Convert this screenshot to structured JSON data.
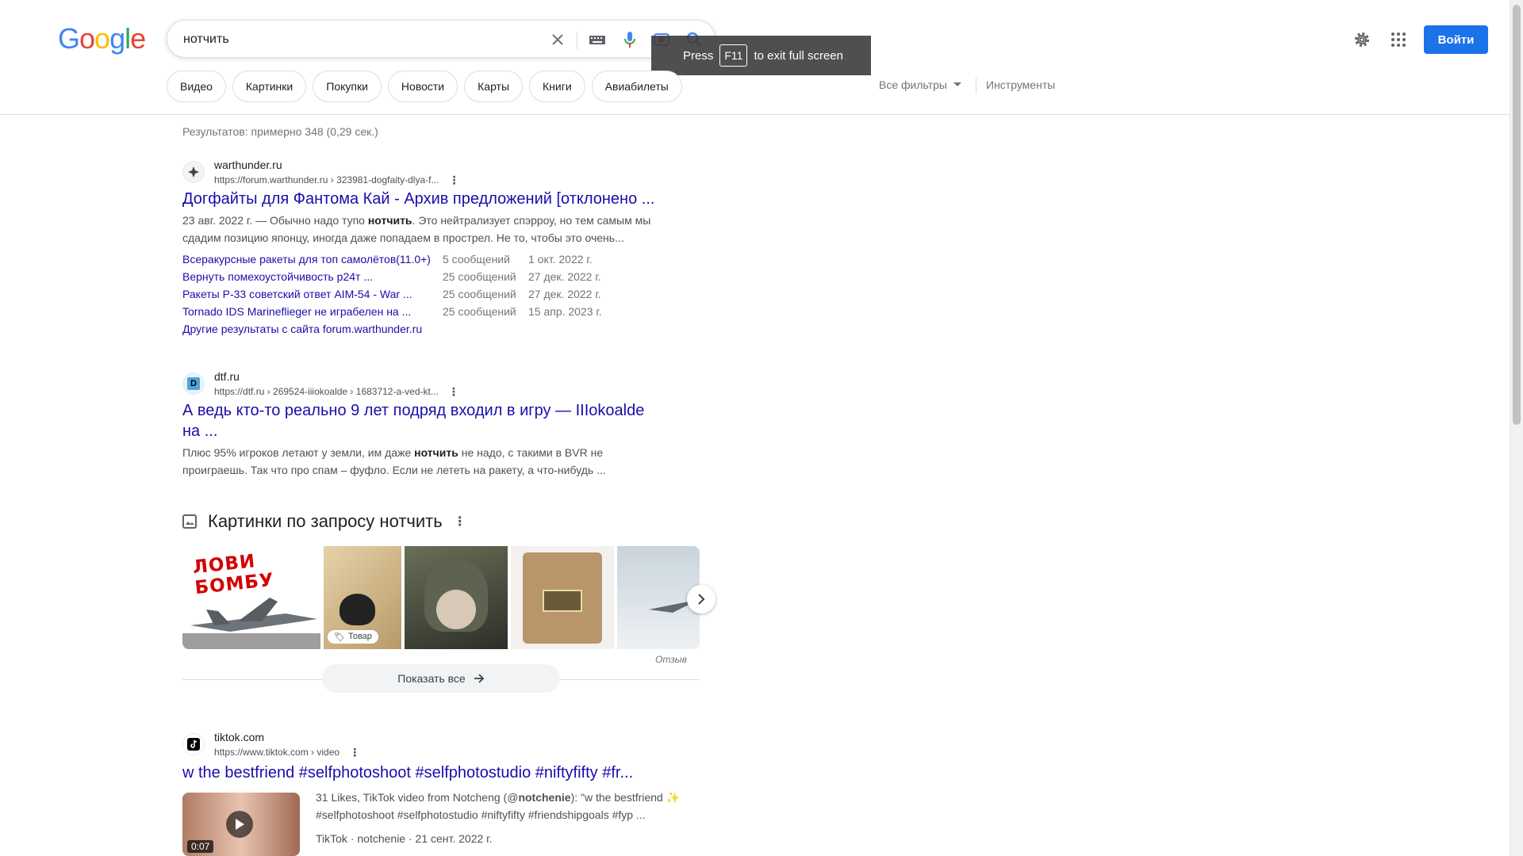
{
  "header": {
    "logo_letters": [
      "G",
      "o",
      "o",
      "g",
      "l",
      "e"
    ],
    "search_value": "нотчить",
    "fullscreen_toast": {
      "press": "Press",
      "key": "F11",
      "rest": "to exit full screen"
    },
    "signin_label": "Войти",
    "chips": [
      "Видео",
      "Картинки",
      "Покупки",
      "Новости",
      "Карты",
      "Книги",
      "Авиабилеты"
    ],
    "all_filters": "Все фильтры",
    "tools": "Инструменты"
  },
  "stats": "Результатов: примерно 348 (0,29 сек.)",
  "results": [
    {
      "site": "warthunder.ru",
      "url": "https://forum.warthunder.ru › 323981-dogfaity-dlya-f...",
      "title": "Догфайты для Фантома Кай - Архив предложений [отклонено ...",
      "snippet_pre": "23 авг. 2022 г. — Обычно надо тупо ",
      "snippet_bold": "нотчить",
      "snippet_post": ". Это нейтрализует спэрроу, но тем самым мы сдадим позицию японцу, иногда даже попадаем в прострел. Не то, чтобы это очень...",
      "sitelinks": [
        {
          "title": "Всеракурсные ракеты для топ самолётов(11.0+)",
          "count": "5 сообщений",
          "date": "1 окт. 2022 г."
        },
        {
          "title": "Вернуть помехоустойчивость р24т ...",
          "count": "25 сообщений",
          "date": "27 дек. 2022 г."
        },
        {
          "title": "Ракеты Р-33 советский ответ AIM-54 - War ...",
          "count": "25 сообщений",
          "date": "27 дек. 2022 г."
        },
        {
          "title": "Tornado IDS Marineflieger не играбелен на ...",
          "count": "25 сообщений",
          "date": "15 апр. 2023 г."
        }
      ],
      "more": "Другие результаты с сайта forum.warthunder.ru"
    },
    {
      "site": "dtf.ru",
      "favicon_letter": "D",
      "url": "https://dtf.ru › 269524-iiiokoalde › 1683712-a-ved-kt...",
      "title_line1": "А ведь кто-то реально 9 лет подряд входил в игру — IIIokoalde",
      "title_line2": "на ...",
      "snippet_pre": "Плюс 95% игроков летают у земли, им даже ",
      "snippet_bold": "нотчить",
      "snippet_post": " не надо, с такими в BVR не проиграешь. Так что про спам – фуфло. Если не лететь на ракету, а что-нибудь ..."
    },
    {
      "site": "tiktok.com",
      "url": "https://www.tiktok.com › video",
      "title": "w the bestfriend #selfphotoshoot #selfphotostudio #niftyfifty #fr...",
      "snippet_pre": "31 Likes, TikTok video from Notcheng (@",
      "snippet_bold": "notchenie",
      "snippet_post": "): \"w the bestfriend ✨ #selfphotoshoot #selfphotostudio #niftyfifty #friendshipgoals #fyp ...",
      "meta": "TikTok · notchenie · 21 сент. 2022 г.",
      "duration": "0:07"
    }
  ],
  "images": {
    "heading": "Картинки по запросу нотчить",
    "thumb1_text": "ЛОВИ БОМБУ",
    "product_tag": "Товар",
    "review_label": "Отзыв",
    "show_all": "Показать все"
  }
}
